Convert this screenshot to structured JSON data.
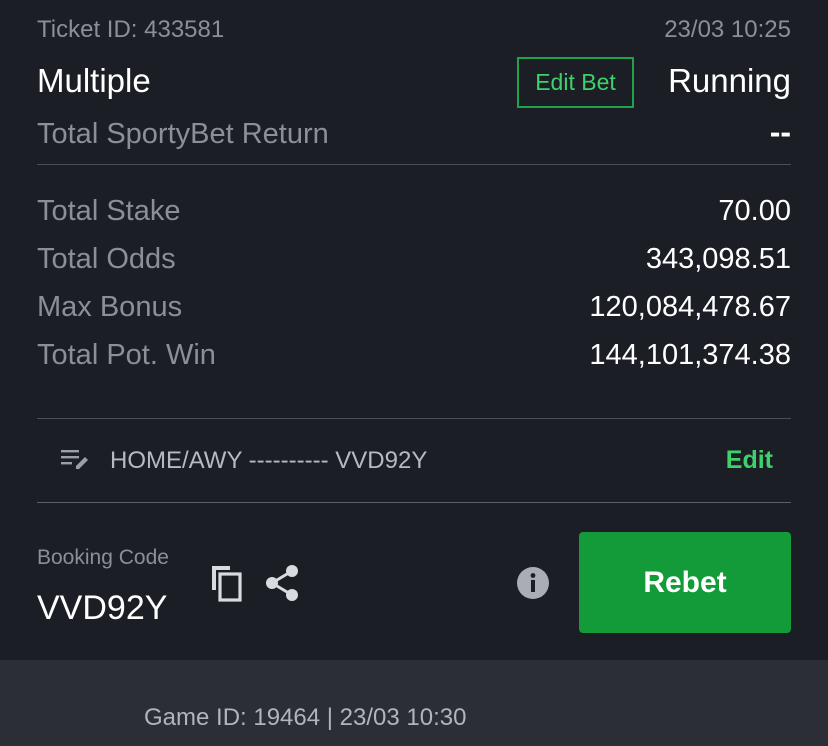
{
  "ticket": {
    "id_label": "Ticket ID: 433581",
    "datetime": "23/03 10:25",
    "type": "Multiple",
    "edit_bet_label": "Edit Bet",
    "status": "Running",
    "return_label": "Total SportyBet Return",
    "return_value": "--"
  },
  "summary": [
    {
      "label": "Total Stake",
      "value": "70.00"
    },
    {
      "label": "Total Odds",
      "value": "343,098.51"
    },
    {
      "label": "Max Bonus",
      "value": "120,084,478.67"
    },
    {
      "label": "Total Pot. Win",
      "value": "144,101,374.38"
    }
  ],
  "note": {
    "icon": "edit-note-icon",
    "text": "HOME/AWY ---------- VVD92Y",
    "edit_label": "Edit"
  },
  "booking": {
    "label": "Booking Code",
    "code": "VVD92Y",
    "copy_icon": "copy-icon",
    "share_icon": "share-icon",
    "info_icon": "info-icon",
    "rebet_label": "Rebet"
  },
  "game": {
    "info": "Game ID: 19464 | 23/03 10:30"
  },
  "colors": {
    "background": "#1b1e24",
    "footer_background": "#2b2e34",
    "accent_green": "#3cd16b",
    "button_green": "#129b38",
    "muted_text": "#8a8f99"
  }
}
